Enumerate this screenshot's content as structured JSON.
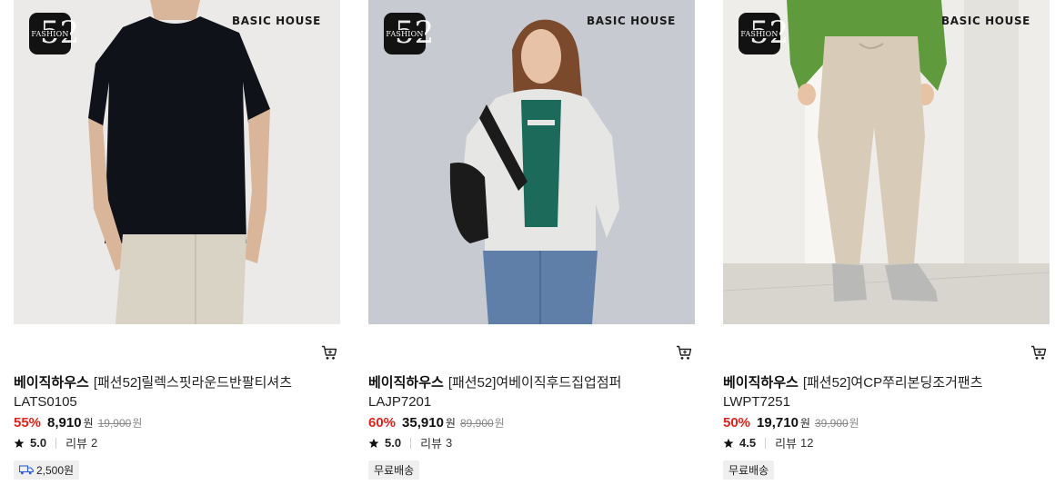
{
  "products": [
    {
      "badge_big": "52",
      "badge_small": "FASHION",
      "image_brand": "BASIC HOUSE",
      "brand": "베이직하우스",
      "name": "[패션52]릴렉스핏라운드반팔티셔츠",
      "code": "LATS0105",
      "discount": "55%",
      "price": "8,910",
      "price_unit": "원",
      "original_price": "19,900",
      "original_unit": "원",
      "rating": "5.0",
      "review_label": "리뷰",
      "review_count": "2",
      "shipping": "2,500원"
    },
    {
      "badge_big": "52",
      "badge_small": "FASHION",
      "image_brand": "BASIC HOUSE",
      "brand": "베이직하우스",
      "name": "[패션52]여베이직후드집업점퍼",
      "code": "LAJP7201",
      "discount": "60%",
      "price": "35,910",
      "price_unit": "원",
      "original_price": "89,900",
      "original_unit": "원",
      "rating": "5.0",
      "review_label": "리뷰",
      "review_count": "3",
      "shipping": "무료배송"
    },
    {
      "badge_big": "52",
      "badge_small": "FASHION",
      "image_brand": "BASIC HOUSE",
      "brand": "베이직하우스",
      "name": "[패션52]여CP쭈리본딩조거팬츠",
      "code": "LWPT7251",
      "discount": "50%",
      "price": "19,710",
      "price_unit": "원",
      "original_price": "39,900",
      "original_unit": "원",
      "rating": "4.5",
      "review_label": "리뷰",
      "review_count": "12",
      "shipping": "무료배송"
    }
  ],
  "icons": {
    "cart": "cart-icon",
    "star": "star-icon",
    "truck": "delivery-truck-icon"
  },
  "colors": {
    "discount": "#e0231c",
    "badge_bg": "#efefef"
  }
}
